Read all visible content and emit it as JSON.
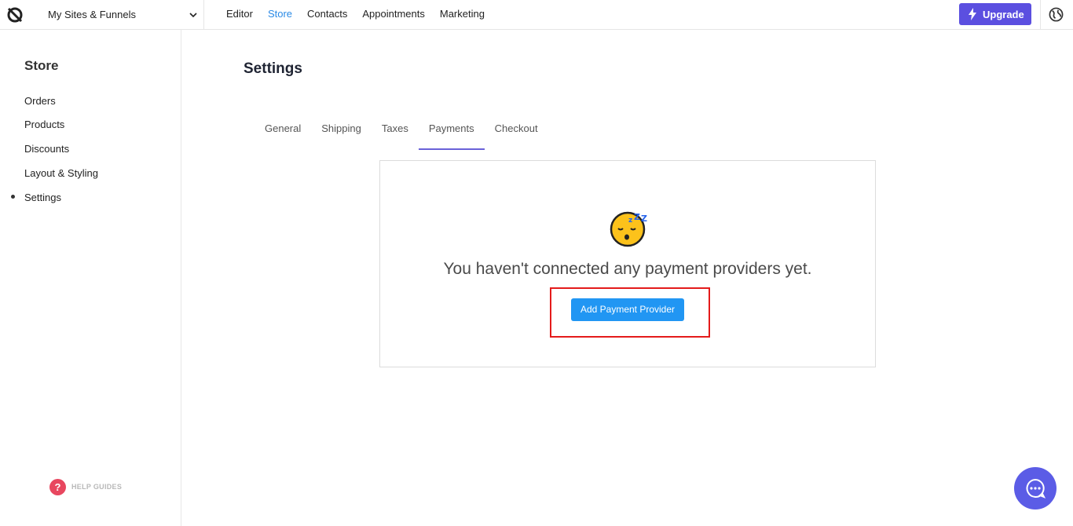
{
  "topbar": {
    "site_selector": "My Sites & Funnels",
    "nav": [
      "Editor",
      "Store",
      "Contacts",
      "Appointments",
      "Marketing"
    ],
    "active_nav": "Store",
    "upgrade_label": "Upgrade",
    "icons": {
      "logo": "brand-logo-icon",
      "chevron": "chevron-down-icon",
      "upgrade": "lightning-bolt-icon",
      "globe": "globe-icon"
    }
  },
  "sidebar": {
    "title": "Store",
    "items": [
      {
        "label": "Orders"
      },
      {
        "label": "Products"
      },
      {
        "label": "Discounts"
      },
      {
        "label": "Layout & Styling"
      },
      {
        "label": "Settings"
      }
    ],
    "active_item": "Settings",
    "help_label": "HELP GUIDES",
    "help_icon_glyph": "?"
  },
  "main": {
    "title": "Settings",
    "tabs": [
      {
        "label": "General"
      },
      {
        "label": "Shipping"
      },
      {
        "label": "Taxes"
      },
      {
        "label": "Payments"
      },
      {
        "label": "Checkout"
      }
    ],
    "active_tab": "Payments",
    "empty_state": {
      "icon": "sleeping-face-icon",
      "message": "You haven't connected any payment providers yet.",
      "button_label": "Add Payment Provider"
    }
  },
  "chat_icon": "chat-bubble-icon",
  "colors": {
    "accent_blue": "#2196f3",
    "upgrade_purple": "#5b4fe0",
    "active_nav": "#2a8ae6",
    "highlight_red": "#e41b1b",
    "tab_underline": "#6a62d8",
    "chat_bg": "#5b5ce6",
    "help_red": "#e8475f"
  }
}
